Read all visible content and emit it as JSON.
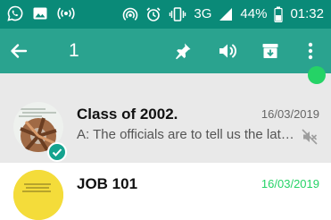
{
  "status_bar": {
    "network": "3G",
    "battery": "44%",
    "time": "01:32",
    "icons": [
      "whatsapp-icon",
      "image-icon",
      "broadcast-icon",
      "hotspot-icon",
      "alarm-icon",
      "vibrate-icon",
      "signal-icon",
      "battery-icon"
    ]
  },
  "action_bar": {
    "selected_count": "1",
    "icons": [
      "back-arrow-icon",
      "pin-icon",
      "unmute-icon",
      "archive-icon",
      "more-options-icon"
    ]
  },
  "chats": [
    {
      "title": "Class of 2002.",
      "date": "16/03/2019",
      "preview": "A: The officials are to tell us the latest news",
      "muted": true,
      "selected": true
    },
    {
      "title": "JOB 101",
      "date": "16/03/2019",
      "unread": true
    }
  ],
  "colors": {
    "status_bar": "#0a8a78",
    "action_bar": "#2aa38f",
    "selected_row": "#e9e9e9",
    "unread_date": "#25d366"
  }
}
